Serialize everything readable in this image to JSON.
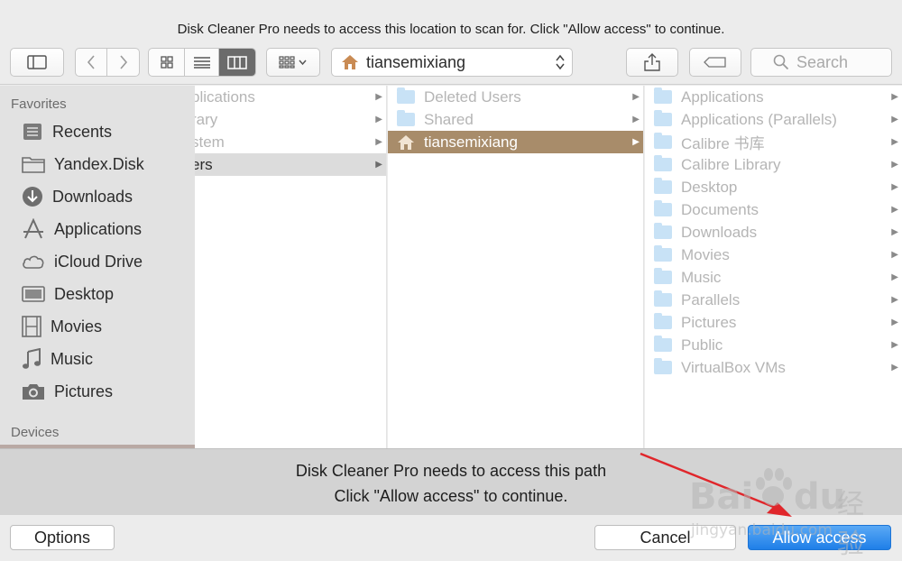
{
  "dialog": {
    "title": "Disk Cleaner Pro needs to access this location to scan for. Click \"Allow access\" to continue."
  },
  "toolbar": {
    "location": "tiansemixiang",
    "search_placeholder": "Search"
  },
  "sidebar": {
    "favorites_header": "Favorites",
    "devices_header": "Devices",
    "items": [
      {
        "label": "Recents",
        "icon": "recents-icon"
      },
      {
        "label": "Yandex.Disk",
        "icon": "folder-icon"
      },
      {
        "label": "Downloads",
        "icon": "downloads-icon"
      },
      {
        "label": "Applications",
        "icon": "applications-icon"
      },
      {
        "label": "iCloud Drive",
        "icon": "cloud-icon"
      },
      {
        "label": "Desktop",
        "icon": "desktop-icon"
      },
      {
        "label": "Movies",
        "icon": "film-icon"
      },
      {
        "label": "Music",
        "icon": "music-icon"
      },
      {
        "label": "Pictures",
        "icon": "camera-icon"
      }
    ]
  },
  "columns": {
    "col1": [
      "plications",
      "rary",
      "stem",
      "ers"
    ],
    "col2": [
      "Deleted Users",
      "Shared",
      "tiansemixiang"
    ],
    "col3": [
      "Applications",
      "Applications (Parallels)",
      "Calibre 书库",
      "Calibre Library",
      "Desktop",
      "Documents",
      "Downloads",
      "Movies",
      "Music",
      "Parallels",
      "Pictures",
      "Public",
      "VirtualBox VMs"
    ]
  },
  "message": {
    "line1": "Disk Cleaner Pro needs to access this path",
    "line2": "Click \"Allow access\" to continue."
  },
  "buttons": {
    "options": "Options",
    "cancel": "Cancel",
    "allow": "Allow access"
  },
  "watermark": {
    "brand": "Bai",
    "brand2": "du",
    "jingyan": "经验",
    "url": "jingyan.baidu.com"
  },
  "colors": {
    "selection": "#a88c6a",
    "primary": "#1f7fe8",
    "folder": "#c8e2f6"
  }
}
